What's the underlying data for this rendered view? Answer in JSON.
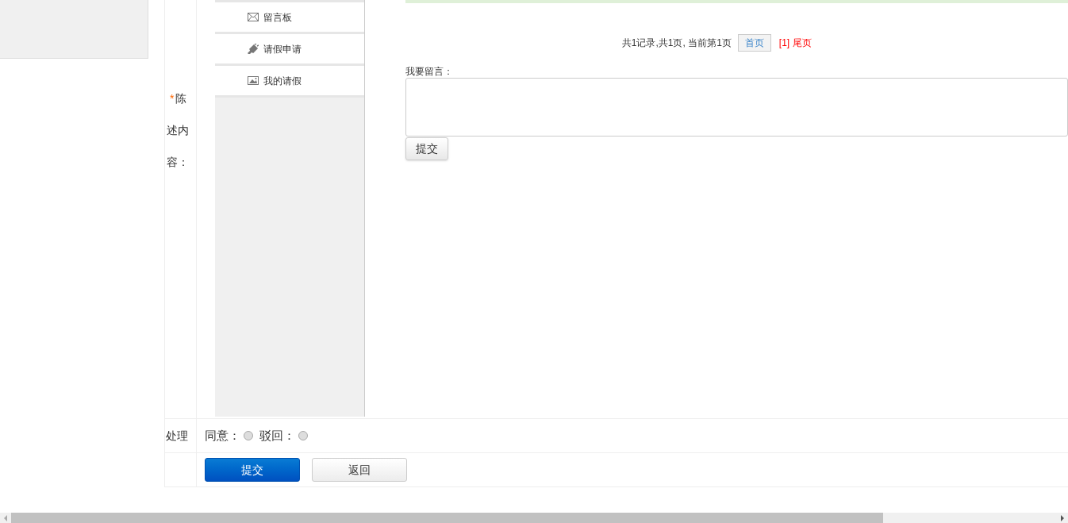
{
  "menu": [
    {
      "label": "留言板",
      "kind": "mail"
    },
    {
      "label": "请假申请",
      "kind": "plug"
    },
    {
      "label": "我的请假",
      "kind": "image"
    }
  ],
  "description_label": {
    "required_mark": "*",
    "text": "陈述内容："
  },
  "pagination": {
    "summary": "共1记录,共1页, 当前第1页",
    "first": "首页",
    "pages": "[1]",
    "last": "尾页"
  },
  "message": {
    "label": "我要留言：",
    "submit": "提交"
  },
  "process": {
    "label": "处理",
    "options": [
      {
        "label": "同意：",
        "selected": false
      },
      {
        "label": "驳回：",
        "selected": false
      }
    ]
  },
  "buttons": [
    {
      "label": "提交",
      "kind": "primary"
    },
    {
      "label": "返回",
      "kind": "secondary"
    }
  ]
}
